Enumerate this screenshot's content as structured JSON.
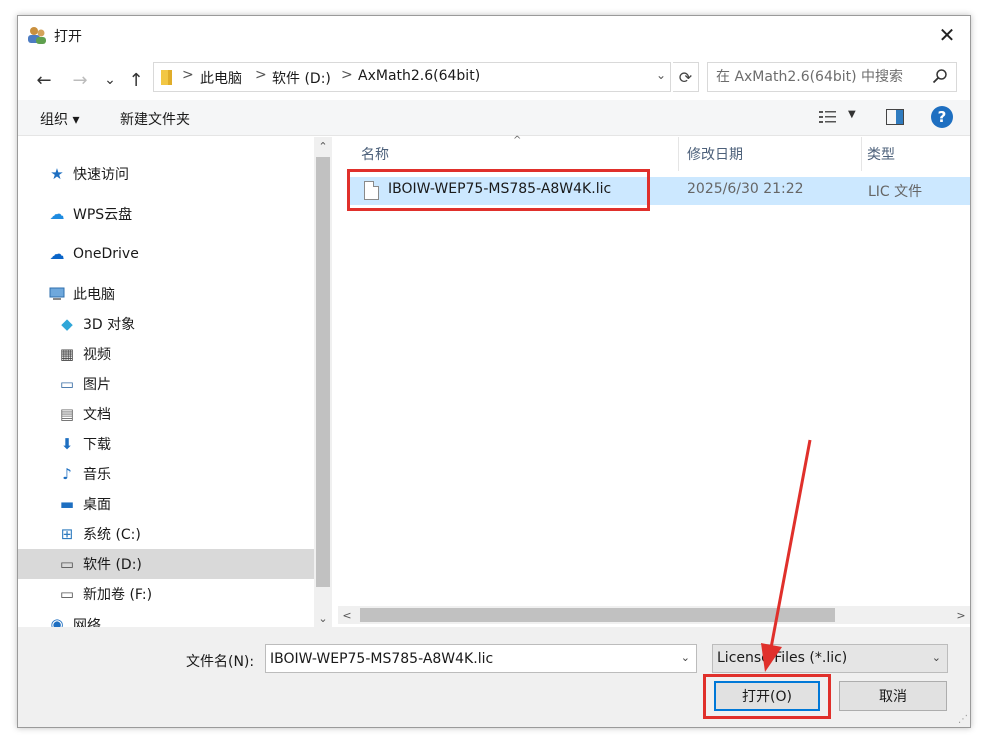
{
  "window": {
    "title": "打开",
    "close_glyph": "✕"
  },
  "address": {
    "back_glyph": "←",
    "forward_glyph": "→",
    "recent_glyph": "⌄",
    "up_glyph": "↑",
    "crumbs": [
      "此电脑",
      "软件 (D:)",
      "AxMath2.6(64bit)"
    ],
    "separator": ">",
    "refresh_glyph": "⟳",
    "search_placeholder": "在 AxMath2.6(64bit) 中搜索"
  },
  "toolbar": {
    "organize_label": "组织 ▾",
    "new_folder_label": "新建文件夹",
    "help_label": "?"
  },
  "sidebar": {
    "items": [
      {
        "label": "快速访问",
        "icon": "star-icon",
        "glyph": "★",
        "color": "#1e6fc1"
      },
      {
        "label": "WPS云盘",
        "icon": "cloud-icon",
        "glyph": "☁",
        "color": "#1e8be0"
      },
      {
        "label": "OneDrive",
        "icon": "onedrive-icon",
        "glyph": "☁",
        "color": "#0a64c8"
      },
      {
        "label": "此电脑",
        "icon": "computer-icon",
        "glyph": "🖥",
        "color": "#2f7bbf"
      },
      {
        "label": "3D 对象",
        "icon": "cube-icon",
        "glyph": "◆",
        "color": "#2fa6d8"
      },
      {
        "label": "视频",
        "icon": "film-icon",
        "glyph": "▦",
        "color": "#444444"
      },
      {
        "label": "图片",
        "icon": "picture-icon",
        "glyph": "▭",
        "color": "#3a6ea5"
      },
      {
        "label": "文档",
        "icon": "document-icon",
        "glyph": "▤",
        "color": "#666666"
      },
      {
        "label": "下载",
        "icon": "download-icon",
        "glyph": "⬇",
        "color": "#1e6fc1"
      },
      {
        "label": "音乐",
        "icon": "music-icon",
        "glyph": "♪",
        "color": "#1e6fc1"
      },
      {
        "label": "桌面",
        "icon": "desktop-icon",
        "glyph": "▬",
        "color": "#1e6fc1"
      },
      {
        "label": "系统 (C:)",
        "icon": "system-drive-icon",
        "glyph": "⊞",
        "color": "#2f7bbf"
      },
      {
        "label": "软件 (D:)",
        "icon": "drive-icon",
        "glyph": "▭",
        "color": "#555555"
      },
      {
        "label": "新加卷 (F:)",
        "icon": "drive-icon",
        "glyph": "▭",
        "color": "#555555"
      },
      {
        "label": "网络",
        "icon": "network-icon",
        "glyph": "◉",
        "color": "#1e6fc1"
      }
    ],
    "scroll_up_glyph": "⌃",
    "scroll_down_glyph": "⌄"
  },
  "filelist": {
    "columns": [
      "名称",
      "修改日期",
      "类型"
    ],
    "sort_glyph": "^",
    "rows": [
      {
        "name": "IBOIW-WEP75-MS785-A8W4K.lic",
        "date": "2025/6/30 21:22",
        "type": "LIC 文件"
      }
    ],
    "hscroll_left_glyph": "<",
    "hscroll_right_glyph": ">"
  },
  "bottom": {
    "filename_label": "文件名(N):",
    "filename_value": "IBOIW-WEP75-MS785-A8W4K.lic",
    "filter_value": "License Files (*.lic)",
    "dropdown_glyph": "⌄",
    "open_label": "打开(O)",
    "cancel_label": "取消"
  },
  "colors": {
    "accent": "#0078d7",
    "selection": "#cce8ff",
    "annotation": "#e0302b"
  }
}
